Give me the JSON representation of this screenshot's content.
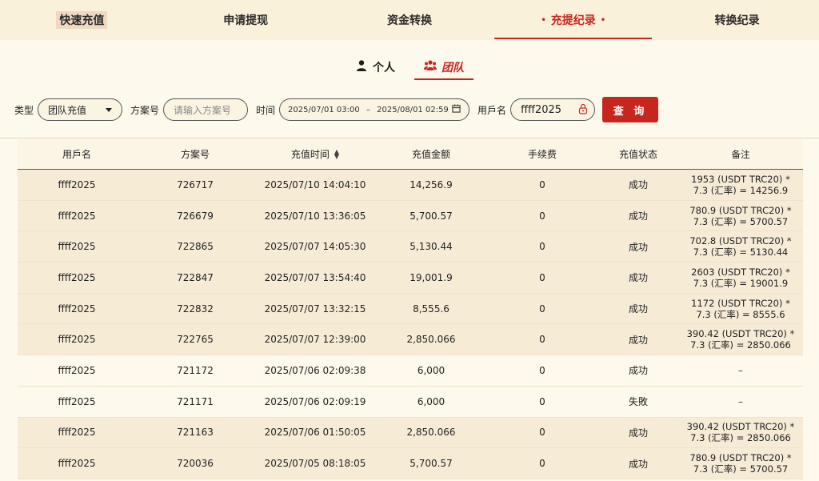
{
  "tabs": [
    {
      "label": "快速充值",
      "active": false
    },
    {
      "label": "申请提现",
      "active": false
    },
    {
      "label": "资金转换",
      "active": false
    },
    {
      "label": "充提纪录",
      "active": true
    },
    {
      "label": "转换纪录",
      "active": false
    }
  ],
  "active_tab_dots": "•",
  "subtabs": [
    {
      "label": "个人",
      "icon": "person-icon",
      "active": false
    },
    {
      "label": "团队",
      "icon": "team-icon",
      "active": true
    }
  ],
  "filters": {
    "type_label": "类型",
    "type_value": "团队充值",
    "plan_label": "方案号",
    "plan_placeholder": "请输入方案号",
    "time_label": "时间",
    "date_start": "2025/07/01 03:00",
    "date_sep": "–",
    "date_end": "2025/08/01 02:59",
    "user_label": "用戶名",
    "user_value": "ffff2025",
    "query_label": "查 询"
  },
  "table": {
    "headers": [
      "用戶名",
      "方案号",
      "充值时间",
      "充值金额",
      "手续费",
      "充值状态",
      "备注"
    ],
    "rows": [
      {
        "user": "ffff2025",
        "plan": "726717",
        "time": "2025/07/10 14:04:10",
        "amount": "14,256.9",
        "fee": "0",
        "status": "成功",
        "note1": "1953 (USDT TRC20) *",
        "note2": "7.3 (汇率) = 14256.9"
      },
      {
        "user": "ffff2025",
        "plan": "726679",
        "time": "2025/07/10 13:36:05",
        "amount": "5,700.57",
        "fee": "0",
        "status": "成功",
        "note1": "780.9 (USDT TRC20) *",
        "note2": "7.3 (汇率) = 5700.57"
      },
      {
        "user": "ffff2025",
        "plan": "722865",
        "time": "2025/07/07 14:05:30",
        "amount": "5,130.44",
        "fee": "0",
        "status": "成功",
        "note1": "702.8 (USDT TRC20) *",
        "note2": "7.3 (汇率) = 5130.44"
      },
      {
        "user": "ffff2025",
        "plan": "722847",
        "time": "2025/07/07 13:54:40",
        "amount": "19,001.9",
        "fee": "0",
        "status": "成功",
        "note1": "2603 (USDT TRC20) *",
        "note2": "7.3 (汇率) = 19001.9"
      },
      {
        "user": "ffff2025",
        "plan": "722832",
        "time": "2025/07/07 13:32:15",
        "amount": "8,555.6",
        "fee": "0",
        "status": "成功",
        "note1": "1172 (USDT TRC20) *",
        "note2": "7.3 (汇率) = 8555.6"
      },
      {
        "user": "ffff2025",
        "plan": "722765",
        "time": "2025/07/07 12:39:00",
        "amount": "2,850.066",
        "fee": "0",
        "status": "成功",
        "note1": "390.42 (USDT TRC20) *",
        "note2": "7.3 (汇率) = 2850.066"
      },
      {
        "user": "ffff2025",
        "plan": "721172",
        "time": "2025/07/06 02:09:38",
        "amount": "6,000",
        "fee": "0",
        "status": "成功",
        "note1": "–",
        "note2": ""
      },
      {
        "user": "ffff2025",
        "plan": "721171",
        "time": "2025/07/06 02:09:19",
        "amount": "6,000",
        "fee": "0",
        "status": "失敗",
        "note1": "–",
        "note2": ""
      },
      {
        "user": "ffff2025",
        "plan": "721163",
        "time": "2025/07/06 01:50:05",
        "amount": "2,850.066",
        "fee": "0",
        "status": "成功",
        "note1": "390.42 (USDT TRC20) *",
        "note2": "7.3 (汇率) = 2850.066"
      },
      {
        "user": "ffff2025",
        "plan": "720036",
        "time": "2025/07/05 08:18:05",
        "amount": "5,700.57",
        "fee": "0",
        "status": "成功",
        "note1": "780.9 (USDT TRC20) *",
        "note2": "7.3 (汇率) = 5700.57"
      }
    ]
  },
  "colors": {
    "accent": "#c7261e",
    "background": "#fdf9ec"
  }
}
